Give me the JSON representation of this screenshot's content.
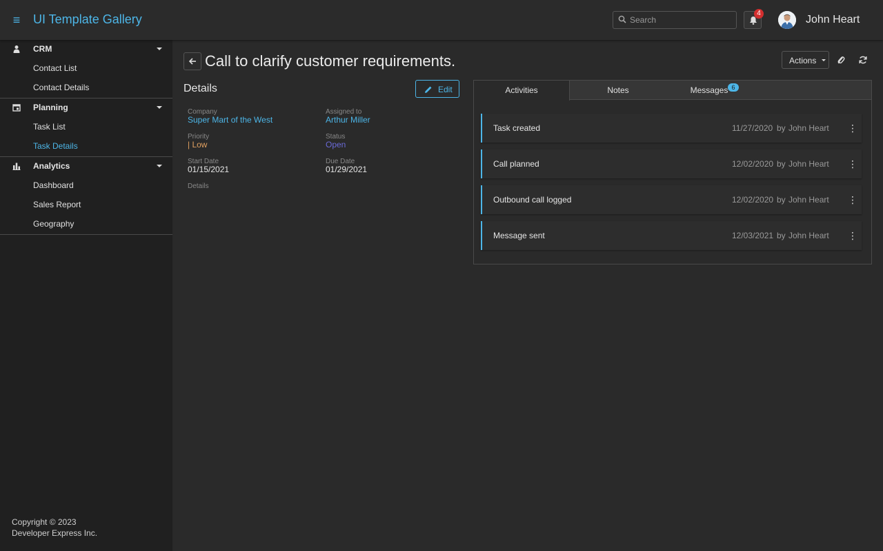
{
  "header": {
    "app_title": "UI Template Gallery",
    "search_placeholder": "Search",
    "notification_count": "4",
    "user_name": "John Heart"
  },
  "sidebar": {
    "groups": [
      {
        "label": "CRM",
        "icon": "person-icon",
        "items": [
          {
            "label": "Contact List"
          },
          {
            "label": "Contact Details"
          }
        ]
      },
      {
        "label": "Planning",
        "icon": "calendar-icon",
        "items": [
          {
            "label": "Task List"
          },
          {
            "label": "Task Details",
            "active": true
          }
        ]
      },
      {
        "label": "Analytics",
        "icon": "bar-chart-icon",
        "items": [
          {
            "label": "Dashboard"
          },
          {
            "label": "Sales Report"
          },
          {
            "label": "Geography"
          }
        ]
      }
    ],
    "footer": {
      "line1": "Copyright © 2023",
      "line2": "Developer Express Inc."
    }
  },
  "page": {
    "title": "Call to clarify customer requirements.",
    "actions_label": "Actions"
  },
  "details": {
    "title": "Details",
    "edit_label": "Edit",
    "company_label": "Company",
    "company": "Super Mart of the West",
    "assigned_label": "Assigned to",
    "assigned": "Arthur Miller",
    "priority_label": "Priority",
    "priority": "| Low",
    "status_label": "Status",
    "status": "Open",
    "start_label": "Start Date",
    "start": "01/15/2021",
    "due_label": "Due Date",
    "due": "01/29/2021",
    "details_label": "Details"
  },
  "tabs": [
    {
      "label": "Activities",
      "active": true
    },
    {
      "label": "Notes"
    },
    {
      "label": "Messages",
      "badge": "6"
    }
  ],
  "activities": [
    {
      "name": "Task created",
      "date": "11/27/2020",
      "by": "by",
      "user": "John Heart"
    },
    {
      "name": "Call planned",
      "date": "12/02/2020",
      "by": "by",
      "user": "John Heart"
    },
    {
      "name": "Outbound call logged",
      "date": "12/02/2020",
      "by": "by",
      "user": "John Heart"
    },
    {
      "name": "Message sent",
      "date": "12/03/2021",
      "by": "by",
      "user": "John Heart"
    }
  ],
  "colors": {
    "accent": "#4db6e8",
    "background": "#2a2a2a",
    "sidebar": "#202020",
    "badge_red": "#d32f2f",
    "priority_low": "#e0a060",
    "status_open": "#6a6ad8"
  }
}
